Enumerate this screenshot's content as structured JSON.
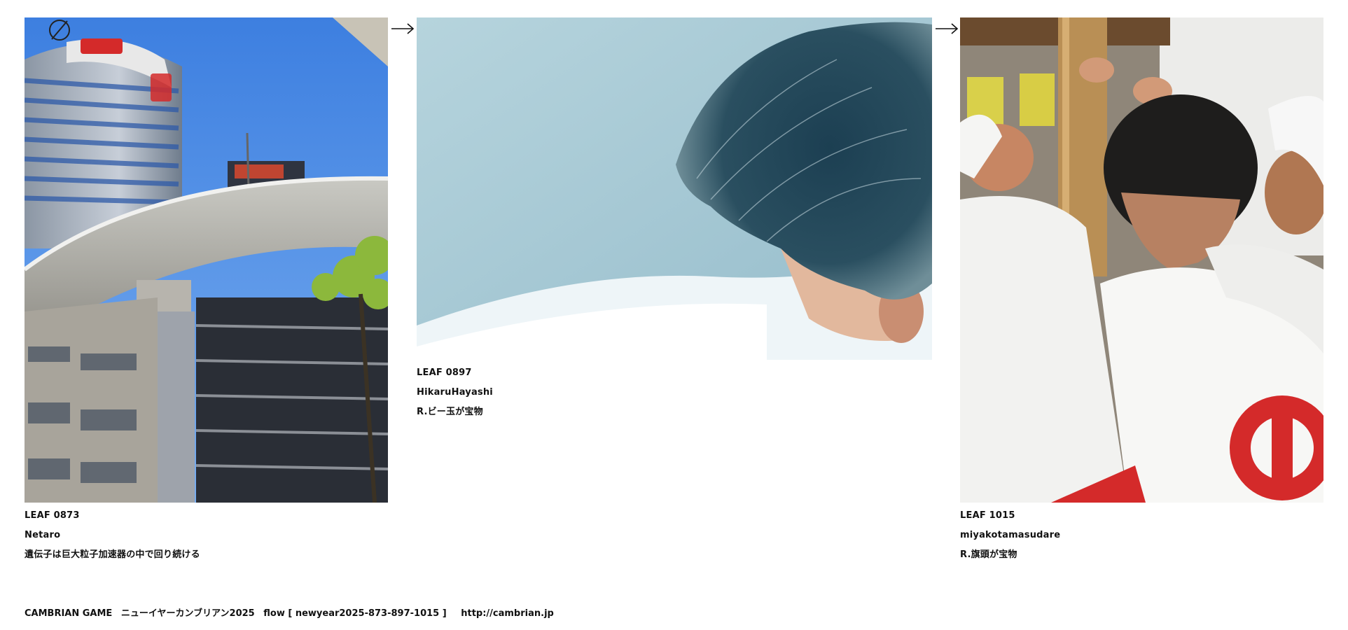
{
  "leaves": [
    {
      "id": "LEAF 0873",
      "author": "Netaro",
      "title": "遺伝子は巨大粒子加速器の中で回り続ける"
    },
    {
      "id": "LEAF 0897",
      "author": "HikaruHayashi",
      "title": "R.ビー玉が宝物"
    },
    {
      "id": "LEAF 1015",
      "author": "miyakotamasudare",
      "title": "R.旗頭が宝物"
    }
  ],
  "footer": {
    "game": "CAMBRIAN GAME",
    "event": "ニューイヤーカンブリアン2025",
    "flow": "flow [ newyear2025-873-897-1015 ]",
    "url": "http://cambrian.jp"
  },
  "icons": {
    "arrow": "arrow-right-icon",
    "logo": "corner-ring-icon"
  },
  "colors": {
    "sky": "#5b93e6",
    "teal": "#a9ccd6",
    "hair": "#1f3a48",
    "red": "#d32b2b"
  }
}
